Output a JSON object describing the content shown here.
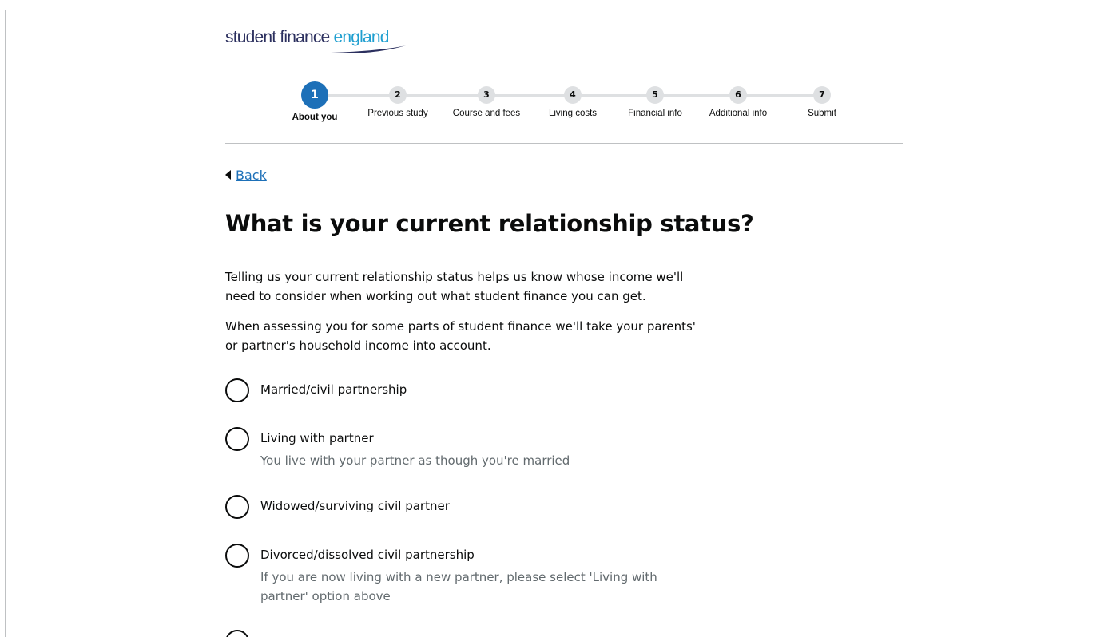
{
  "logo": {
    "word1": "student finance ",
    "word2": "england"
  },
  "stepper": {
    "active": 1,
    "steps": [
      {
        "num": "1",
        "label": "About you"
      },
      {
        "num": "2",
        "label": "Previous study"
      },
      {
        "num": "3",
        "label": "Course and fees"
      },
      {
        "num": "4",
        "label": "Living costs"
      },
      {
        "num": "5",
        "label": "Financial info"
      },
      {
        "num": "6",
        "label": "Additional info"
      },
      {
        "num": "7",
        "label": "Submit"
      }
    ]
  },
  "back_label": "Back",
  "page_title": "What is your current relationship status?",
  "intro": [
    "Telling us your current relationship status helps us know whose income we'll need to consider when working out what student finance you can get.",
    "When assessing you for some parts of student finance we'll take your parents' or partner's household income into account."
  ],
  "options": [
    {
      "label": "Married/civil partnership",
      "hint": ""
    },
    {
      "label": "Living with partner",
      "hint": "You live with your partner as though you're married"
    },
    {
      "label": "Widowed/surviving civil partner",
      "hint": ""
    },
    {
      "label": "Divorced/dissolved civil partnership",
      "hint": "If you are now living with a new partner, please select 'Living with partner' option above"
    }
  ],
  "colors": {
    "brand_navy": "#2b2f5e",
    "brand_cyan": "#1f9fd0",
    "active_step": "#1d70b8",
    "link": "#1d70b8"
  }
}
